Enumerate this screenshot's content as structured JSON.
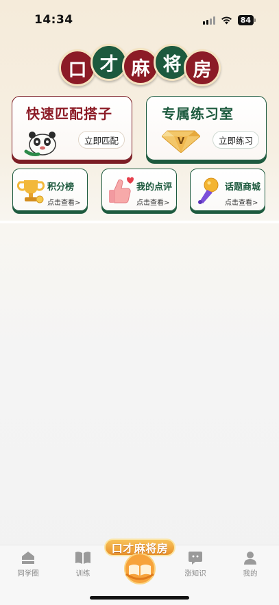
{
  "status_bar": {
    "time": "14:34",
    "battery": "84"
  },
  "title_tiles": [
    "口",
    "才",
    "麻",
    "将",
    "房"
  ],
  "big_cards": [
    {
      "title": "快速匹配搭子",
      "button": "立即匹配",
      "icon": "panda-icon"
    },
    {
      "title": "专属练习室",
      "button": "立即练习",
      "icon": "diamond-v-icon"
    }
  ],
  "small_cards": [
    {
      "title": "积分榜",
      "sub": "点击查看>",
      "icon": "trophy-icon"
    },
    {
      "title": "我的点评",
      "sub": "点击查看>",
      "icon": "thumbs-up-icon"
    },
    {
      "title": "话题商城",
      "sub": "点击查看>",
      "icon": "microphone-icon"
    }
  ],
  "tab_bar": {
    "tabs": [
      {
        "label": "同学圈",
        "icon": "home-icon"
      },
      {
        "label": "训练",
        "icon": "book-icon"
      },
      {
        "label": "涨知识",
        "icon": "chat-icon"
      },
      {
        "label": "我的",
        "icon": "user-icon"
      }
    ],
    "center": {
      "label": "口才麻将房",
      "icon": "book-bowl-icon"
    }
  },
  "colors": {
    "red": "#8c1b26",
    "green": "#1d5a3e",
    "gold": "#e8912a"
  }
}
